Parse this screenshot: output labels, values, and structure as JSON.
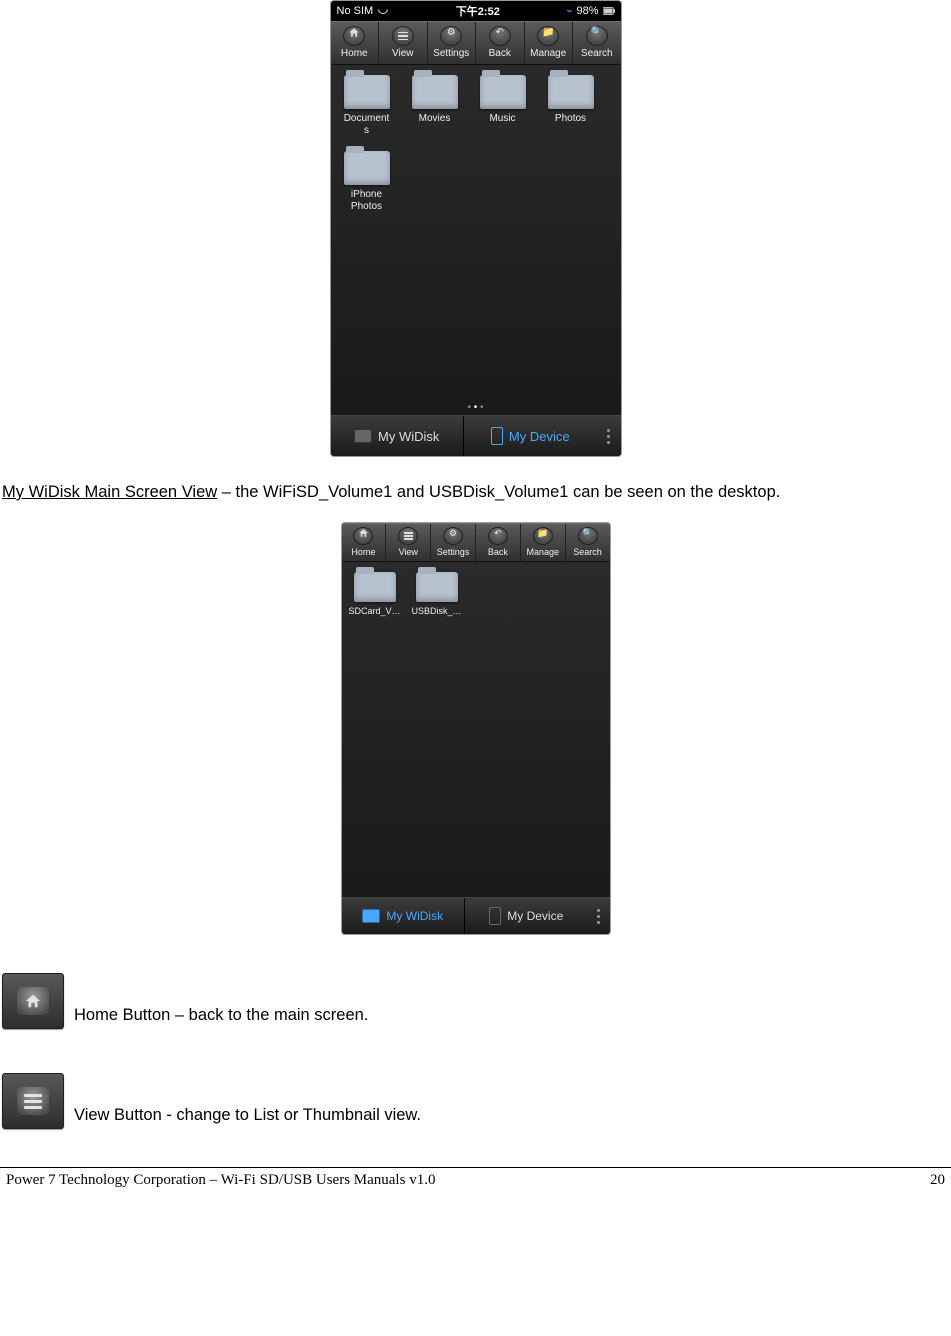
{
  "screenshot1": {
    "status": {
      "carrier": "No SIM",
      "time": "下午2:52",
      "battery": "98%"
    },
    "toolbar": [
      {
        "label": "Home",
        "icon": "home-icon"
      },
      {
        "label": "View",
        "icon": "list-icon"
      },
      {
        "label": "Settings",
        "icon": "gear-icon"
      },
      {
        "label": "Back",
        "icon": "back-icon"
      },
      {
        "label": "Manage",
        "icon": "folder-open-icon"
      },
      {
        "label": "Search",
        "icon": "search-icon"
      }
    ],
    "folders": [
      "Document\ns",
      "Movies",
      "Music",
      "Photos",
      "iPhone\nPhotos"
    ],
    "tabs": {
      "left": "My WiDisk",
      "right": "My Device"
    }
  },
  "caption1": {
    "underlined": "My WiDisk Main Screen View",
    "rest": " – the WiFiSD_Volume1 and USBDisk_Volume1 can be seen on the desktop."
  },
  "screenshot2": {
    "toolbar": [
      {
        "label": "Home"
      },
      {
        "label": "View"
      },
      {
        "label": "Settings"
      },
      {
        "label": "Back"
      },
      {
        "label": "Manage"
      },
      {
        "label": "Search"
      }
    ],
    "folders": [
      "SDCard_V…",
      "USBDisk_…"
    ],
    "tabs": {
      "left": "My WiDisk",
      "right": "My Device"
    }
  },
  "buttons": {
    "home": " Home Button – back to the main screen.",
    "view": " View Button - change to List or Thumbnail view."
  },
  "footer": {
    "left": "Power 7 Technology Corporation – Wi-Fi SD/USB Users Manuals v1.0",
    "right": "20"
  }
}
